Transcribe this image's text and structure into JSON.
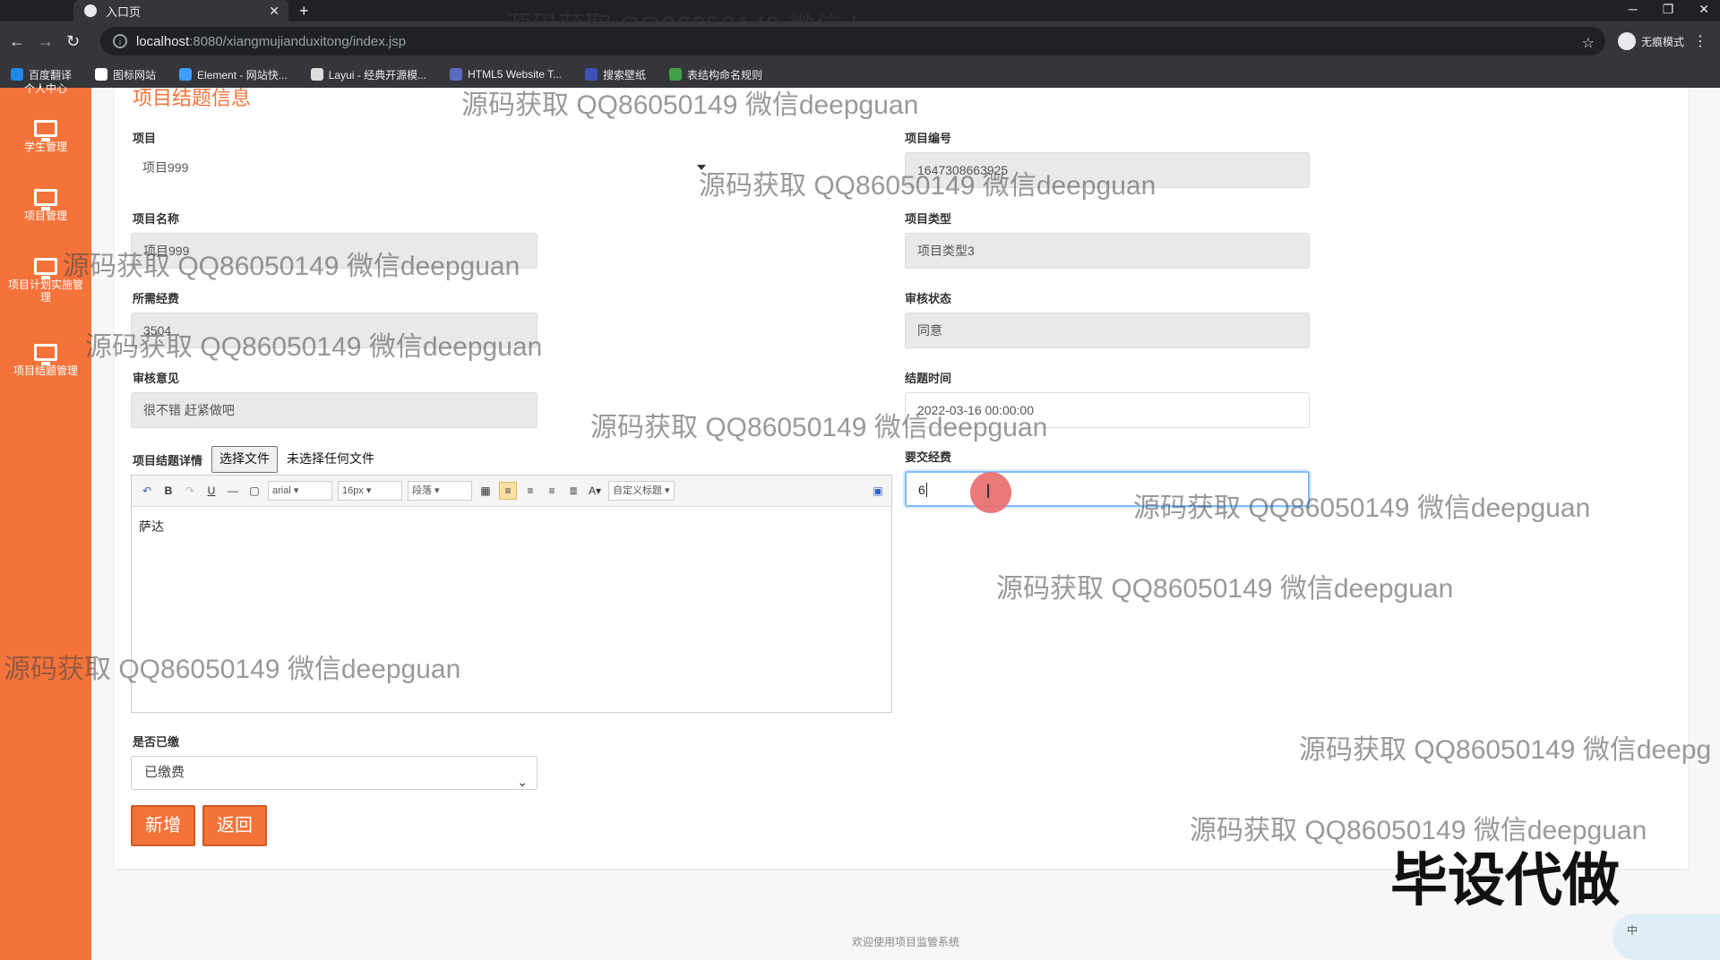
{
  "browser": {
    "tab_title": "入口页",
    "url_host": "localhost",
    "url_path": ":8080/xiangmujianduxitong/index.jsp",
    "incognito_label": "无痕模式",
    "bookmarks": [
      {
        "label": "百度翻译",
        "color": "#1e88e5"
      },
      {
        "label": "图标网站",
        "color": "#ffffff"
      },
      {
        "label": "Element - 网站快...",
        "color": "#409eff"
      },
      {
        "label": "Layui - 经典开源模...",
        "color": "#dddddd"
      },
      {
        "label": "HTML5 Website T...",
        "color": "#5c6bc0"
      },
      {
        "label": "搜索壁纸",
        "color": "#3f51b5"
      },
      {
        "label": "表结构命名规则",
        "color": "#43a047"
      }
    ]
  },
  "sidebar": {
    "items": [
      {
        "label": "个人中心"
      },
      {
        "label": "学生管理"
      },
      {
        "label": "项目管理"
      },
      {
        "label": "项目计划实施管理"
      },
      {
        "label": "项目结题管理"
      }
    ]
  },
  "form": {
    "section_title": "项目结题信息",
    "project_label": "项目",
    "project_value": "项目999",
    "project_no_label": "项目编号",
    "project_no_value": "1647308663925",
    "project_name_label": "项目名称",
    "project_name_value": "项目999",
    "project_type_label": "项目类型",
    "project_type_value": "项目类型3",
    "required_funds_label": "所需经费",
    "required_funds_value": "3504",
    "review_status_label": "审核状态",
    "review_status_value": "同意",
    "review_opinion_label": "审核意见",
    "review_opinion_value": "很不错 赶紧做吧",
    "conclusion_time_label": "结题时间",
    "conclusion_time_value": "2022-03-16 00:00:00",
    "details_label": "项目结题详情",
    "file_button": "选择文件",
    "file_status": "未选择任何文件",
    "submit_funds_label": "要交经费",
    "submit_funds_value": "6",
    "paid_label": "是否已缴",
    "paid_value": "已缴费",
    "add_button": "新增",
    "back_button": "返回"
  },
  "editor": {
    "font": "arial",
    "size": "16px",
    "paragraph": "段落",
    "custom_title": "自定义标题",
    "content": "萨达"
  },
  "footer": {
    "text": "欢迎使用项目监管系统"
  },
  "watermarks": {
    "text": "源码获取 QQ86050149 微信deepguan",
    "text_cut": "源码获取 QQ86050149 微信deepg",
    "big": "毕设代做"
  },
  "ime": {
    "label": "中"
  },
  "colors": {
    "accent": "#f4733a"
  }
}
